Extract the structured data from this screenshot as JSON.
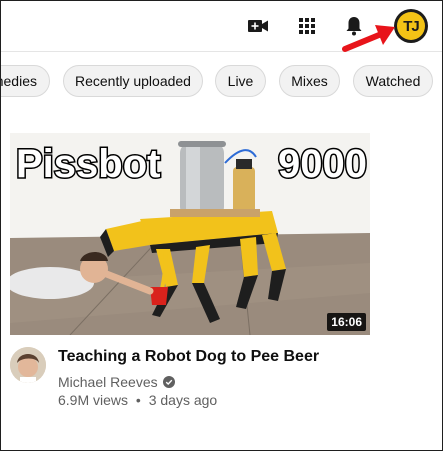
{
  "header": {
    "avatar_initials": "TJ",
    "avatar_colors": {
      "ring": "#1c1c1c",
      "fill": "#f3c316"
    },
    "icons": [
      "create-video-icon",
      "apps-grid-icon",
      "notifications-bell-icon"
    ],
    "annotation_arrow_color": "#e8141a"
  },
  "chips": [
    {
      "label": "medies"
    },
    {
      "label": "Recently uploaded"
    },
    {
      "label": "Live"
    },
    {
      "label": "Mixes"
    },
    {
      "label": "Watched"
    }
  ],
  "video": {
    "thumbnail_text_left": "Pissbot",
    "thumbnail_text_right": "9000",
    "duration": "16:06",
    "title": "Teaching a Robot Dog to Pee Beer",
    "channel": "Michael Reeves",
    "views": "6.9M views",
    "separator": "•",
    "age": "3 days ago"
  }
}
